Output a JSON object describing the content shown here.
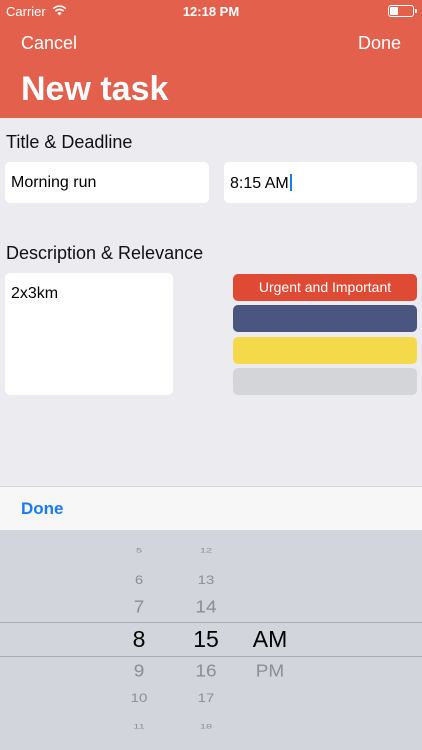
{
  "status_bar": {
    "carrier": "Carrier",
    "time": "12:18 PM"
  },
  "nav": {
    "cancel_label": "Cancel",
    "done_label": "Done",
    "title": "New task"
  },
  "form": {
    "title_section_label": "Title & Deadline",
    "title_value": "Morning run",
    "deadline_value": "8:15 AM",
    "description_section_label": "Description & Relevance",
    "description_value": "2x3km"
  },
  "relevance_options": [
    {
      "label": "Urgent and Important",
      "color": "#df4a35"
    },
    {
      "label": "",
      "color": "#4a5680"
    },
    {
      "label": "",
      "color": "#f4d94b"
    },
    {
      "label": "",
      "color": "#d3d5d8"
    }
  ],
  "keyboard_toolbar": {
    "done_label": "Done"
  },
  "picker": {
    "hours": [
      "5",
      "6",
      "7",
      "8",
      "9",
      "10",
      "11"
    ],
    "minutes": [
      "12",
      "13",
      "14",
      "15",
      "16",
      "17",
      "18"
    ],
    "periods": [
      "AM",
      "PM"
    ],
    "selected": {
      "hour": "8",
      "minute": "15",
      "period": "AM"
    }
  },
  "colors": {
    "header": "#e3604c",
    "accent": "#1a7cf3",
    "background": "#ebebf0"
  }
}
